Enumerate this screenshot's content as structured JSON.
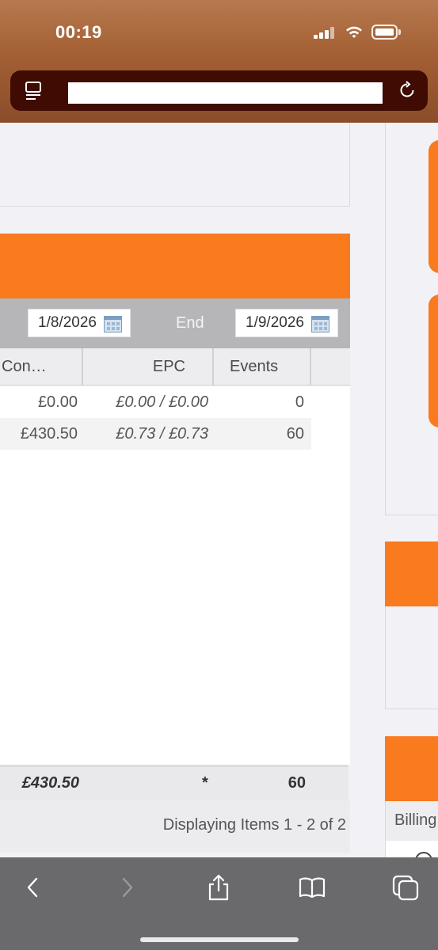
{
  "status_bar": {
    "time": "00:19"
  },
  "url_bar": {
    "url": ""
  },
  "date_filter": {
    "start_value": "1/8/2026",
    "end_label": "End",
    "end_value": "1/9/2026"
  },
  "grid": {
    "columns": [
      "Con…",
      "EPC",
      "Events"
    ],
    "rows": [
      {
        "con": "£0.00",
        "epc": "£0.00 / £0.00",
        "events": "0"
      },
      {
        "con": "£430.50",
        "epc": "£0.73 / £0.73",
        "events": "60"
      }
    ],
    "footer": {
      "total": "£430.50",
      "epc": "*",
      "events": "60"
    },
    "pager_text": "Displaying Items 1 - 2 of 2"
  },
  "side_panel": {
    "billing_label": "Billing"
  },
  "toolbar": {
    "icons": [
      "back-icon",
      "forward-icon",
      "share-icon",
      "bookmarks-icon",
      "tabs-icon"
    ]
  },
  "colors": {
    "accent": "#fa7a1e",
    "statusbar": "#a35f34",
    "urlbar": "#3f0b03",
    "toolbar": "#6a6a6c"
  }
}
